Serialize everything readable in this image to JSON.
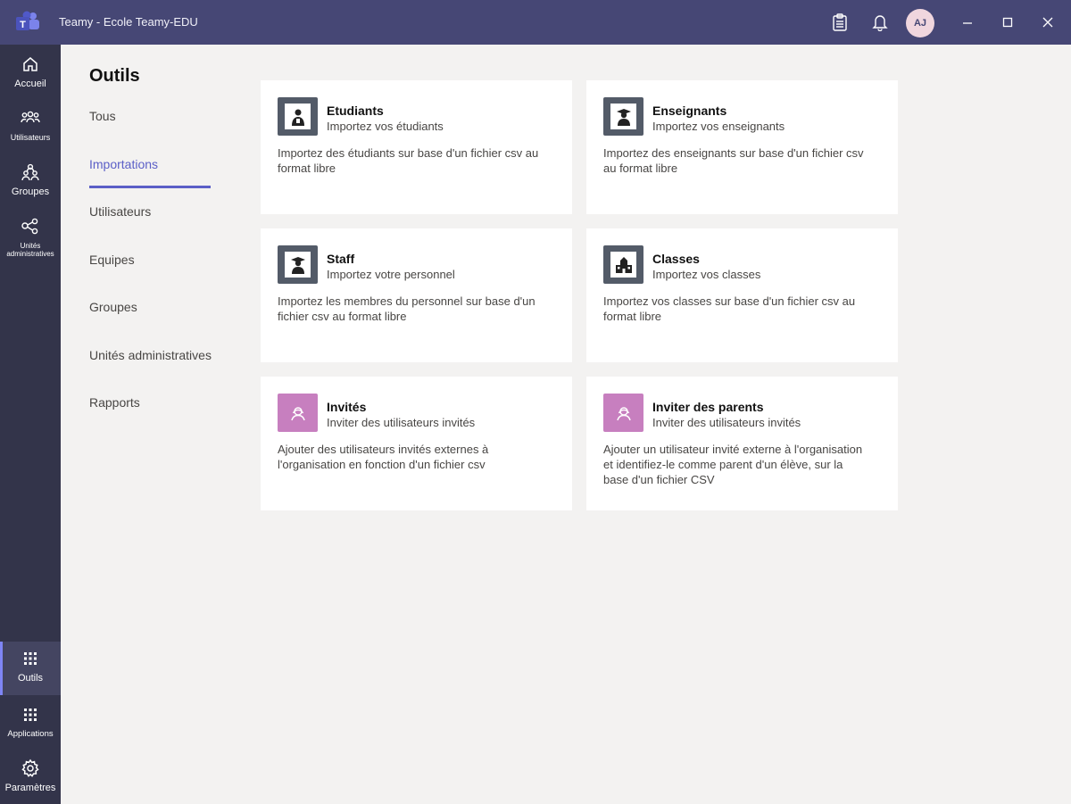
{
  "app": {
    "title": "Teamy - Ecole Teamy-EDU",
    "logo_letter": "T",
    "avatar_initials": "AJ"
  },
  "titlebar_icons": [
    "clipboard-icon",
    "bell-icon",
    "minimize-icon",
    "maximize-icon",
    "close-icon"
  ],
  "rail": {
    "items": [
      {
        "label": "Accueil",
        "icon": "home-icon"
      },
      {
        "label": "Utilisateurs",
        "icon": "users-icon"
      },
      {
        "label": "Groupes",
        "icon": "groups-icon"
      },
      {
        "label": "Unités administratives",
        "icon": "org-units-icon"
      },
      {
        "label": "Outils",
        "icon": "grid-icon",
        "active": true
      },
      {
        "label": "Applications",
        "icon": "apps-icon"
      },
      {
        "label": "Paramètres",
        "icon": "gear-icon"
      }
    ]
  },
  "page": {
    "title": "Outils"
  },
  "nav": {
    "items": [
      {
        "label": "Tous"
      },
      {
        "label": "Importations",
        "active": true
      },
      {
        "label": "Utilisateurs"
      },
      {
        "label": "Equipes"
      },
      {
        "label": "Groupes"
      },
      {
        "label": "Unités administratives"
      },
      {
        "label": "Rapports"
      }
    ]
  },
  "cards": [
    {
      "title": "Etudiants",
      "subtitle": "Importez vos étudiants",
      "description": "Importez des étudiants sur base d'un fichier csv au format libre",
      "icon": "student-icon"
    },
    {
      "title": "Enseignants",
      "subtitle": "Importez vos enseignants",
      "description": "Importez des enseignants sur base d'un fichier csv au format libre",
      "icon": "teacher-icon"
    },
    {
      "title": "Staff",
      "subtitle": "Importez votre personnel",
      "description": "Importez les membres du personnel sur base d'un fichier csv au format libre",
      "icon": "staff-icon"
    },
    {
      "title": "Classes",
      "subtitle": "Importez vos classes",
      "description": "Importez vos classes sur base d'un fichier csv au format libre",
      "icon": "school-icon"
    },
    {
      "title": "Invités",
      "subtitle": "Inviter des utilisateurs invités",
      "description": "Ajouter des utilisateurs invités externes à l'organisation en fonction d'un fichier csv",
      "icon": "guest-icon"
    },
    {
      "title": "Inviter des parents",
      "subtitle": "Inviter des utilisateurs invités",
      "description": "Ajouter un utilisateur invité externe à l'organisation et identifiez-le comme parent d'un élève, sur la base d'un fichier CSV",
      "icon": "parent-guest-icon"
    }
  ],
  "colors": {
    "titlebar": "#464775",
    "rail": "#33344a",
    "accent": "#5b5fc7",
    "card_icon_dark": "#535b68",
    "card_icon_pink": "#c77fbf"
  }
}
